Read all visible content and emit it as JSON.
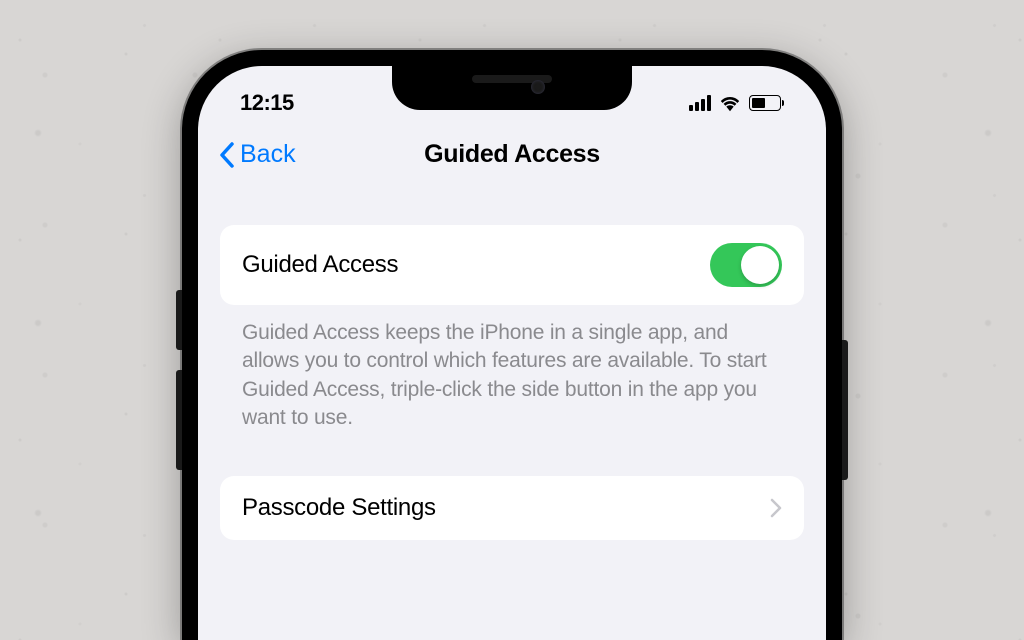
{
  "statusBar": {
    "time": "12:15"
  },
  "navBar": {
    "backLabel": "Back",
    "title": "Guided Access"
  },
  "settings": {
    "toggleRow": {
      "label": "Guided Access",
      "enabled": true
    },
    "description": "Guided Access keeps the iPhone in a single app, and allows you to control which features are available. To start Guided Access, triple-click the side button in the app you want to use.",
    "passcodeRow": {
      "label": "Passcode Settings"
    }
  },
  "colors": {
    "accent": "#007aff",
    "toggleOn": "#34c759",
    "background": "#f2f2f7"
  }
}
